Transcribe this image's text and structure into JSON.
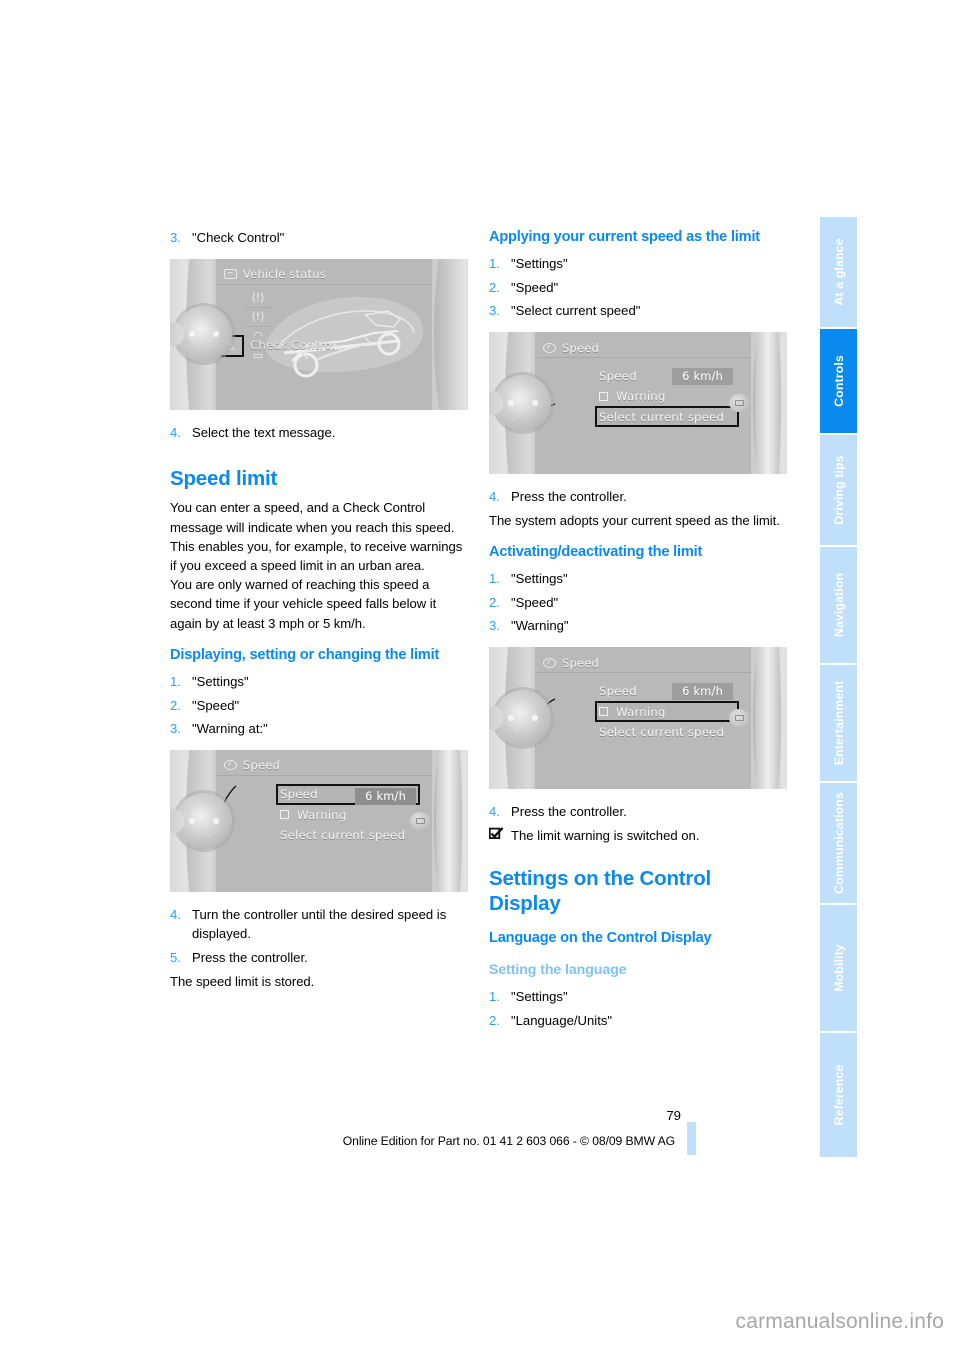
{
  "document": {
    "page_number": "79",
    "imprint": "Online Edition for Part no. 01 41 2 603 066 - © 08/09 BMW AG",
    "watermark": "carmanualsonline.info",
    "accent_color": "#0a8aee",
    "tab_color": "#bfdffa"
  },
  "tabs": [
    {
      "label": "At a glance",
      "active": false
    },
    {
      "label": "Controls",
      "active": true
    },
    {
      "label": "Driving tips",
      "active": false
    },
    {
      "label": "Navigation",
      "active": false
    },
    {
      "label": "Entertainment",
      "active": false
    },
    {
      "label": "Communications",
      "active": false
    },
    {
      "label": "Mobility",
      "active": false
    },
    {
      "label": "Reference",
      "active": false
    }
  ],
  "left_column": {
    "step3": {
      "num": "3.",
      "text": "\"Check Control\""
    },
    "figure_vehicle_status": {
      "title": "Vehicle status",
      "title_icon": "car-status-icon",
      "selected_item": "Check Control",
      "selected_icon": "warning-triangle-icon",
      "strip_icons": [
        "tire-pressure-icon",
        "tire-pressure-low-icon",
        "oil-level-icon",
        "vehicle-icon"
      ]
    },
    "step4": {
      "num": "4.",
      "text": "Select the text message."
    },
    "heading_speed_limit": "Speed limit",
    "intro_paragraph_1": "You can enter a speed, and a Check Control message will indicate when you reach this speed. This enables you, for example, to receive warnings if you exceed a speed limit in an urban area.",
    "intro_paragraph_2": "You are only warned of reaching this speed a second time if your vehicle speed falls below it again by at least 3 mph or 5 km/h.",
    "heading_displaying": "Displaying, setting or changing the limit",
    "steps_displaying": [
      {
        "num": "1.",
        "text": "\"Settings\""
      },
      {
        "num": "2.",
        "text": "\"Speed\""
      },
      {
        "num": "3.",
        "text": "\"Warning at:\""
      }
    ],
    "figure_speed_warning_at": {
      "title": "Speed",
      "title_icon": "speedometer-icon",
      "rows": [
        {
          "label": "Speed",
          "value": "6 km/h",
          "selected": true,
          "checkbox": false
        },
        {
          "label": "Warning",
          "value": "",
          "selected": false,
          "checkbox": true
        },
        {
          "label": "Select current speed",
          "value": "",
          "selected": false,
          "checkbox": false
        }
      ]
    },
    "steps_after_figure": [
      {
        "num": "4.",
        "text": "Turn the controller until the desired speed is displayed."
      },
      {
        "num": "5.",
        "text": "Press the controller."
      }
    ],
    "closing_text": "The speed limit is stored."
  },
  "right_column": {
    "heading_applying": "Applying your current speed as the limit",
    "steps_applying": [
      {
        "num": "1.",
        "text": "\"Settings\""
      },
      {
        "num": "2.",
        "text": "\"Speed\""
      },
      {
        "num": "3.",
        "text": "\"Select current speed\""
      }
    ],
    "figure_select_current_speed": {
      "title": "Speed",
      "title_icon": "speedometer-icon",
      "rows": [
        {
          "label": "Speed",
          "value": "6 km/h",
          "selected": false,
          "checkbox": false
        },
        {
          "label": "Warning",
          "value": "",
          "selected": false,
          "checkbox": true
        },
        {
          "label": "Select current speed",
          "value": "",
          "selected": true,
          "checkbox": false
        }
      ]
    },
    "step4_applying": {
      "num": "4.",
      "text": "Press the controller."
    },
    "text_adopts": "The system adopts your current speed as the limit.",
    "heading_activating": "Activating/deactivating the limit",
    "steps_activating": [
      {
        "num": "1.",
        "text": "\"Settings\""
      },
      {
        "num": "2.",
        "text": "\"Speed\""
      },
      {
        "num": "3.",
        "text": "\"Warning\""
      }
    ],
    "figure_warning": {
      "title": "Speed",
      "title_icon": "speedometer-icon",
      "rows": [
        {
          "label": "Speed",
          "value": "6 km/h",
          "selected": false,
          "checkbox": false
        },
        {
          "label": "Warning",
          "value": "",
          "selected": true,
          "checkbox": true
        },
        {
          "label": "Select current speed",
          "value": "",
          "selected": false,
          "checkbox": false
        }
      ]
    },
    "step4_activating": {
      "num": "4.",
      "text": "Press the controller."
    },
    "note_result": {
      "icon": "checkmark-box-icon",
      "text": "The limit warning is switched on."
    },
    "heading_settings_control_display": "Settings on the Control Display",
    "heading_language": "Language on the Control Display",
    "heading_setting_language": "Setting the language",
    "steps_language": [
      {
        "num": "1.",
        "text": "\"Settings\""
      },
      {
        "num": "2.",
        "text": "\"Language/Units\""
      }
    ]
  }
}
